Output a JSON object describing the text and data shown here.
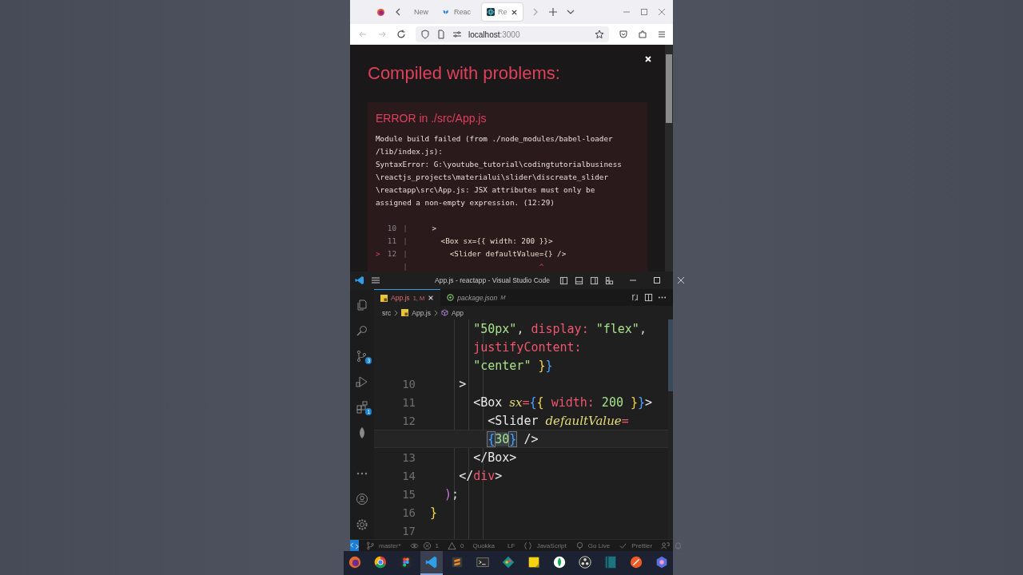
{
  "browser": {
    "tabs": [
      {
        "label": "New",
        "kind": "plain",
        "selected": false
      },
      {
        "label": "Reac",
        "kind": "mui",
        "selected": false
      },
      {
        "label": "Re",
        "kind": "react",
        "selected": true
      }
    ],
    "url_host": "localhost",
    "url_port": ":3000"
  },
  "error_overlay": {
    "title": "Compiled with problems:",
    "error_heading": "ERROR in ./src/App.js",
    "message_lines": [
      "Module build failed (from ./node_modules/babel-loader",
      "/lib/index.js):",
      "SyntaxError: G:\\youtube_tutorial\\codingtutorialbusiness",
      "\\reactjs_projects\\materialui\\slider\\discreate_slider",
      "\\reactapp\\src\\App.js: JSX attributes must only be",
      "assigned a non-empty expression. (12:29)"
    ],
    "code_frame": [
      {
        "number": "10",
        "gutter": "|",
        "code": "    >"
      },
      {
        "number": "11",
        "gutter": "|",
        "code": "      <Box sx={{ width: 200 }}>"
      },
      {
        "marker": ">",
        "number": "12",
        "gutter": "|",
        "code": "        <Slider defaultValue={} />"
      },
      {
        "gutter": "|",
        "code": "                            ^"
      }
    ]
  },
  "editor": {
    "title": "App.js - reactapp - Visual Studio Code",
    "tabs": [
      {
        "label": "App.js",
        "status": "1, M",
        "kind": "js",
        "selected": true
      },
      {
        "label": "package.json",
        "status": "M",
        "kind": "json",
        "selected": false
      }
    ],
    "breadcrumb": [
      {
        "label": "src",
        "kind": "folder"
      },
      {
        "label": "App.js",
        "kind": "js"
      },
      {
        "label": "App",
        "kind": "component"
      }
    ],
    "activity": [
      {
        "kind": "explorer"
      },
      {
        "kind": "search"
      },
      {
        "kind": "source-control",
        "badge": "3"
      },
      {
        "kind": "run"
      },
      {
        "kind": "extensions",
        "badge": "1"
      },
      {
        "kind": "leaf"
      },
      {
        "kind": "more"
      }
    ],
    "lines": [
      {
        "current": false,
        "tokens": [
          {
            "text": "      \"50px\"",
            "kind": "str"
          },
          {
            "text": ", ",
            "kind": "punct"
          },
          {
            "text": "display: ",
            "kind": "prop"
          },
          {
            "text": "\"flex\"",
            "kind": "str"
          },
          {
            "text": ",",
            "kind": "punct"
          }
        ]
      },
      {
        "current": false,
        "tokens": [
          {
            "text": "      justifyContent:",
            "kind": "prop"
          }
        ]
      },
      {
        "current": false,
        "tokens": [
          {
            "text": "      \"center\" ",
            "kind": "str"
          },
          {
            "text": "}",
            "kind": "brace1"
          },
          {
            "text": "}",
            "kind": "brace2"
          }
        ]
      },
      {
        "number": "10",
        "current": false,
        "tokens": [
          {
            "text": "    >",
            "kind": "tag"
          }
        ]
      },
      {
        "number": "11",
        "current": false,
        "tokens": [
          {
            "text": "      <Box ",
            "kind": "tag"
          },
          {
            "text": "sx",
            "kind": "attr"
          },
          {
            "text": "=",
            "kind": "prop"
          },
          {
            "text": "{",
            "kind": "brace2"
          },
          {
            "text": "{",
            "kind": "brace1"
          },
          {
            "text": " width: ",
            "kind": "prop"
          },
          {
            "text": "200 ",
            "kind": "num"
          },
          {
            "text": "}",
            "kind": "brace1"
          },
          {
            "text": "}",
            "kind": "brace2"
          },
          {
            "text": ">",
            "kind": "tag"
          }
        ]
      },
      {
        "number": "12",
        "current": false,
        "tokens": [
          {
            "text": "        <Slider ",
            "kind": "tag"
          },
          {
            "text": "defaultValue",
            "kind": "attr"
          },
          {
            "text": "=",
            "kind": "prop"
          }
        ]
      },
      {
        "current": true,
        "tokens": [
          {
            "text": "        {",
            "kind": "match"
          },
          {
            "text": "30",
            "kind": "selected"
          },
          {
            "text": "}",
            "kind": "match"
          },
          {
            "text": " />",
            "kind": "tag"
          }
        ]
      },
      {
        "number": "13",
        "current": false,
        "tokens": [
          {
            "text": "      </Box>",
            "kind": "tag"
          }
        ]
      },
      {
        "number": "14",
        "current": false,
        "tokens": [
          {
            "text": "    </",
            "kind": "tag"
          },
          {
            "text": "div",
            "kind": "tagname"
          },
          {
            "text": ">",
            "kind": "tag"
          }
        ]
      },
      {
        "number": "15",
        "current": false,
        "tokens": [
          {
            "text": "  )",
            "kind": "paren"
          },
          {
            "text": ";",
            "kind": "punct"
          }
        ]
      },
      {
        "number": "16",
        "current": false,
        "tokens": [
          {
            "text": "}",
            "kind": "brace1"
          }
        ]
      },
      {
        "number": "17",
        "current": false
      }
    ]
  },
  "status_bar": {
    "branch": "master*",
    "errors": "1",
    "warnings": "0",
    "items": [
      {
        "label": "Quokka",
        "kind": "text"
      },
      {
        "label": "LF",
        "kind": "text"
      },
      {
        "label": "JavaScript",
        "kind": "braces"
      },
      {
        "label": "Go Live",
        "kind": "broadcast"
      },
      {
        "label": "Prettier",
        "kind": "check"
      }
    ]
  },
  "taskbar": [
    {
      "kind": "fox",
      "selected": false
    },
    {
      "kind": "chrome",
      "selected": false
    },
    {
      "kind": "figma",
      "selected": false
    },
    {
      "kind": "vscode",
      "selected": true
    },
    {
      "kind": "sublime",
      "selected": false
    },
    {
      "kind": "terminal",
      "selected": false
    },
    {
      "kind": "git",
      "selected": false
    },
    {
      "kind": "note",
      "selected": false
    },
    {
      "kind": "leaf",
      "selected": false
    },
    {
      "kind": "obs",
      "selected": false
    },
    {
      "kind": "panel",
      "selected": false
    },
    {
      "kind": "postman",
      "selected": false
    },
    {
      "kind": "copilot",
      "selected": false
    }
  ]
}
